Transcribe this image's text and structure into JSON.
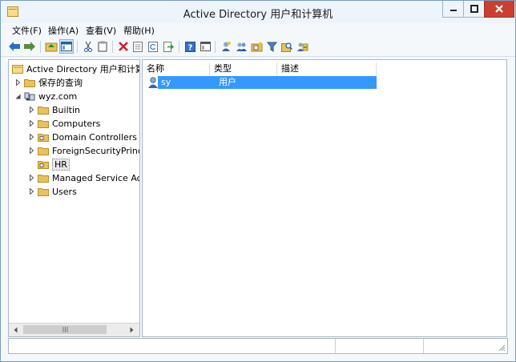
{
  "window": {
    "title": "Active Directory 用户和计算机"
  },
  "menubar": {
    "items": [
      "文件(F)",
      "操作(A)",
      "查看(V)",
      "帮助(H)"
    ]
  },
  "toolbar": {
    "icons": [
      "back-arrow-icon",
      "forward-arrow-icon",
      "up-folder-icon",
      "show-console-tree-icon",
      "cut-icon",
      "copy-icon",
      "delete-icon",
      "properties-icon",
      "refresh-icon",
      "export-list-icon",
      "help-icon",
      "view-icon",
      "new-user-icon",
      "new-group-icon",
      "new-ou-icon",
      "filter-icon",
      "find-icon",
      "add-to-group-icon"
    ]
  },
  "tree": {
    "root": "Active Directory 用户和计算机",
    "saved_queries": "保存的查询",
    "domain": "wyz.com",
    "children": [
      "Builtin",
      "Computers",
      "Domain Controllers",
      "ForeignSecurityPrincipa",
      "HR",
      "Managed Service Acco",
      "Users"
    ],
    "selected": "HR"
  },
  "list": {
    "columns": [
      "名称",
      "类型",
      "描述"
    ],
    "rows": [
      {
        "name": "sy",
        "type": "用户",
        "description": ""
      }
    ]
  },
  "colors": {
    "selection": "#3399ff",
    "close_button": "#c94031",
    "folder": "#e8c25b"
  }
}
